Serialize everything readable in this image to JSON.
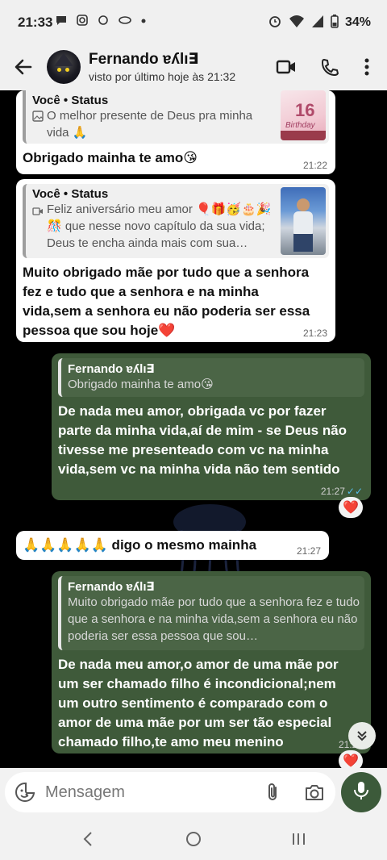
{
  "status_bar": {
    "time": "21:33",
    "battery": "34%"
  },
  "header": {
    "contact_name": "Fernando ɐʎlı∃",
    "last_seen": "visto por último hoje às 21:32"
  },
  "messages": [
    {
      "direction": "incoming",
      "quote_title": "Você • Status",
      "quote_text": "O melhor presente de Deus pra minha vida 🙏",
      "thumb_caption_1": "16",
      "thumb_caption_2": "Birthday",
      "text": "Obrigado mainha te amo😘",
      "time": "21:22"
    },
    {
      "direction": "incoming",
      "quote_title": "Você • Status",
      "quote_text": "Feliz aniversário meu amor 🎈🎁🥳🎂🎉🎊 que nesse novo capítulo da sua vida; Deus te encha ainda mais com sua…",
      "text": "Muito obrigado mãe por tudo que a senhora fez e tudo que a senhora e na minha vida,sem a senhora eu não poderia ser essa pessoa que sou hoje❤️",
      "time": "21:23"
    },
    {
      "direction": "outgoing",
      "quote_title": "Fernando ɐʎlı∃",
      "quote_text": "Obrigado mainha te amo😘",
      "text": "De nada meu amor, obrigada vc por fazer parte da minha vida,aí de mim - se Deus não tivesse me presenteado com vc na minha vida,sem vc na minha vida não tem sentido",
      "time": "21:27",
      "reaction": "❤️"
    },
    {
      "direction": "incoming",
      "text": "🙏🙏🙏🙏🙏 digo o mesmo mainha",
      "time": "21:27"
    },
    {
      "direction": "outgoing",
      "quote_title": "Fernando ɐʎlı∃",
      "quote_text": "Muito obrigado mãe por tudo que a senhora fez e tudo que a senhora e na minha vida,sem a senhora eu não poderia ser essa pessoa que sou…",
      "text": "De nada meu amor,o amor de uma mãe por um ser chamado filho é incondicional;nem um outro sentimento é comparado com o amor de uma mãe por um ser tão especial chamado filho,te amo meu menino",
      "time": "21:29",
      "reaction": "❤️"
    }
  ],
  "composer": {
    "placeholder": "Mensagem"
  },
  "colors": {
    "outgoing_bubble": "#3f5a3a",
    "incoming_bubble": "#ffffff",
    "mic_button": "#3c5a3a",
    "read_ticks": "#53bdeb"
  }
}
